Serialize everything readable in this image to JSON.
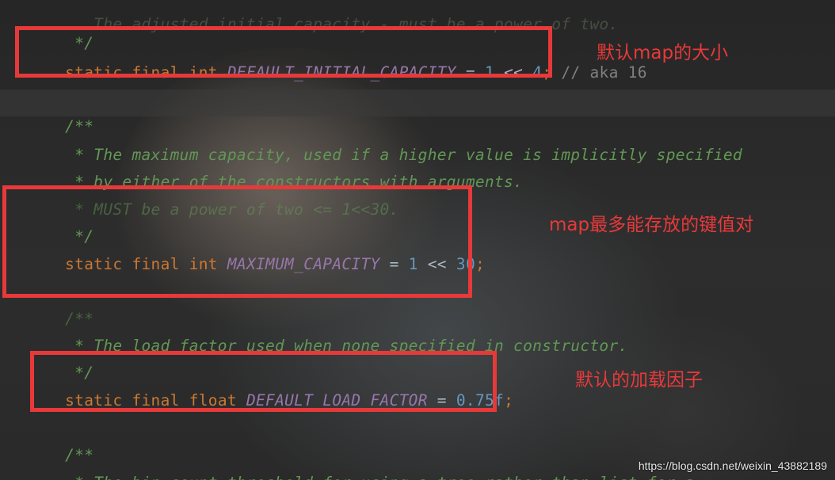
{
  "code": {
    "line_top_comment": "   The adjusted initial capacity - must be a power of two.",
    "line_top_close": " */",
    "l1": {
      "static": "static",
      "final": "final",
      "type": "int",
      "name": "DEFAULT_INITIAL_CAPACITY",
      "eq": "=",
      "val1": "1",
      "shift": "<<",
      "val2": "4",
      "semi": ";",
      "comment": "// aka 16"
    },
    "doc1_open": "/**",
    "doc1_line1": " * The maximum capacity, used if a higher value is implicitly specified",
    "doc1_line2": " * by either of the constructors with arguments.",
    "doc1_line3": " * MUST be a power of two <= 1<<30.",
    "doc1_close": " */",
    "l2": {
      "static": "static",
      "final": "final",
      "type": "int",
      "name": "MAXIMUM_CAPACITY",
      "eq": "=",
      "val1": "1",
      "shift": "<<",
      "val2": "30",
      "semi": ";"
    },
    "doc2_open": "/**",
    "doc2_line1": " * The load factor used when none specified in constructor.",
    "doc2_close": " */",
    "l3": {
      "static": "static",
      "final": "final",
      "type": "float",
      "name": "DEFAULT_LOAD_FACTOR",
      "eq": "=",
      "val": "0.75f",
      "semi": ";"
    },
    "doc3_open": "/**",
    "doc3_line1": " * The bin count threshold for using a tree rather than list for a"
  },
  "annotations": {
    "a1": "默认map的大小",
    "a2": "map最多能存放的键值对",
    "a3": "默认的加载因子"
  },
  "watermark": "https://blog.csdn.net/weixin_43882189",
  "colors": {
    "keyword": "#cc7832",
    "constant": "#9876aa",
    "number": "#6897bb",
    "comment": "#629755",
    "annotation": "#e8393a"
  }
}
